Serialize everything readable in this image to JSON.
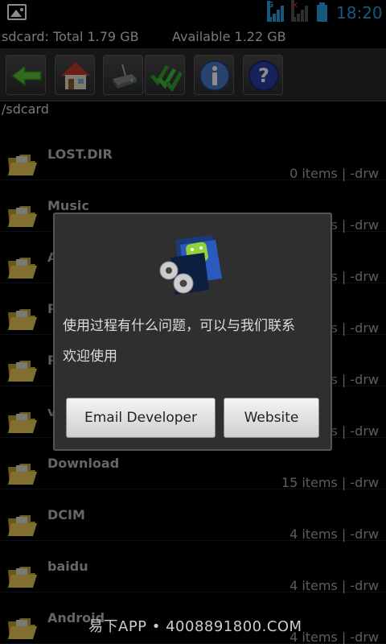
{
  "status_bar": {
    "time": "18:20",
    "network": "G"
  },
  "storage": {
    "total": "sdcard: Total 1.79 GB",
    "available": "Available 1.22 GB"
  },
  "toolbar": {
    "buttons": [
      {
        "name": "back",
        "icon": "back-arrow-icon"
      },
      {
        "name": "home",
        "icon": "home-icon"
      },
      {
        "name": "drive",
        "icon": "drive-icon"
      },
      {
        "name": "multi-select",
        "icon": "checkmarks-icon"
      },
      {
        "name": "info",
        "icon": "info-icon"
      },
      {
        "name": "help",
        "icon": "help-icon"
      }
    ]
  },
  "path": "/sdcard",
  "files": [
    {
      "name": "LOST.DIR",
      "info": "0 items | -drw"
    },
    {
      "name": "Music",
      "info": "s | -drw"
    },
    {
      "name": "A",
      "info": "s | -drw"
    },
    {
      "name": "P",
      "info": "s | -drw"
    },
    {
      "name": "P",
      "info": "s | -drw"
    },
    {
      "name": "v",
      "info": "s | -drw"
    },
    {
      "name": "Download",
      "info": "15 items | -drw"
    },
    {
      "name": "DCIM",
      "info": "4 items | -drw"
    },
    {
      "name": "baidu",
      "info": "4 items | -drw"
    },
    {
      "name": "Android",
      "info": "4 items | -drw"
    }
  ],
  "dialog": {
    "line1": "使用过程有什么问题，可以与我们联系",
    "line2": "欢迎使用",
    "email_button": "Email Developer",
    "website_button": "Website"
  },
  "watermark": "易下APP • 4008891800.COM",
  "colors": {
    "accent": "#2ba3e3",
    "folder": "#e8c04a"
  }
}
